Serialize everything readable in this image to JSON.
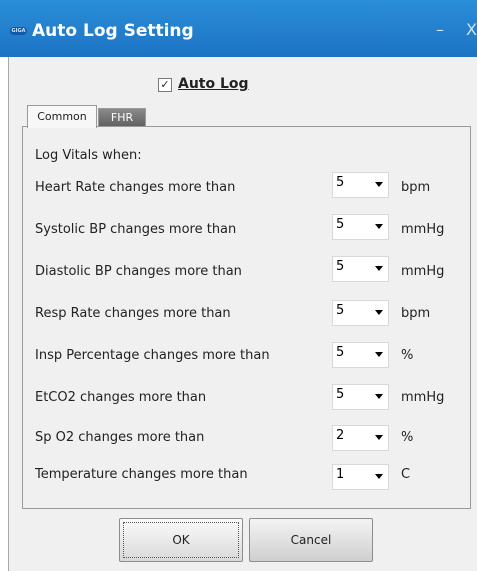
{
  "window": {
    "title": "Auto Log Setting",
    "logo_text": "GIGA",
    "minimize_glyph": "–",
    "close_glyph": "X",
    "colors": {
      "titlebar": "#1d73c4",
      "fhr_tab": "#6a6a6a"
    }
  },
  "auto_log": {
    "label": "Auto Log",
    "checked": true,
    "check_glyph": "✓"
  },
  "tabs": [
    {
      "label": "Common",
      "active": true
    },
    {
      "label": "FHR",
      "active": false
    }
  ],
  "common": {
    "section_label": "Log Vitals when:",
    "rows": [
      {
        "label": "Heart Rate changes more than",
        "value": "5",
        "unit": "bpm"
      },
      {
        "label": "Systolic BP changes more than",
        "value": "5",
        "unit": "mmHg"
      },
      {
        "label": "Diastolic BP changes more than",
        "value": "5",
        "unit": "mmHg"
      },
      {
        "label": "Resp Rate changes more than",
        "value": "5",
        "unit": "bpm"
      },
      {
        "label": "Insp Percentage changes more than",
        "value": "5",
        "unit": "%"
      },
      {
        "label": "EtCO2 changes more than",
        "value": "5",
        "unit": "mmHg"
      },
      {
        "label": "Sp O2 changes more than",
        "value": "2",
        "unit": "%"
      },
      {
        "label": "Temperature changes more than",
        "value": "1",
        "unit": "C"
      }
    ]
  },
  "buttons": {
    "ok": "OK",
    "cancel": "Cancel"
  }
}
